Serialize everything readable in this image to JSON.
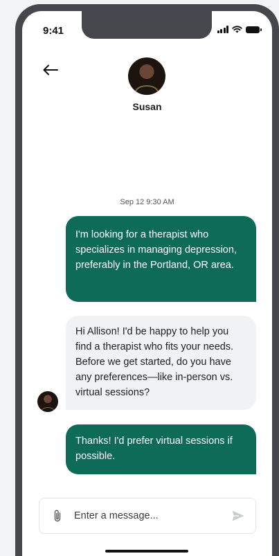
{
  "status_bar": {
    "time": "9:41",
    "icons": [
      "signal-icon",
      "wifi-icon",
      "battery-icon"
    ]
  },
  "header": {
    "back_icon": "arrow-left-icon",
    "contact_name": "Susan",
    "avatar": "contact-avatar"
  },
  "conversation": {
    "timestamp": "Sep 12 9:30 AM",
    "messages": [
      {
        "direction": "outgoing",
        "text": "I'm looking for a therapist who specializes in managing depression, preferably in the Portland, OR area."
      },
      {
        "direction": "incoming",
        "text": "Hi Allison! I'd be happy to help you find a therapist who fits your needs. Before we get started, do you have any preferences—like in-person vs. virtual sessions?"
      },
      {
        "direction": "outgoing",
        "text": "Thanks! I'd prefer virtual sessions if possible."
      }
    ]
  },
  "composer": {
    "placeholder": "Enter a message...",
    "value": "",
    "attach_icon": "paperclip-icon",
    "send_icon": "send-icon"
  },
  "colors": {
    "outgoing_bubble": "#0e6b58",
    "incoming_bubble": "#f1f2f4",
    "frame": "#45474c"
  }
}
